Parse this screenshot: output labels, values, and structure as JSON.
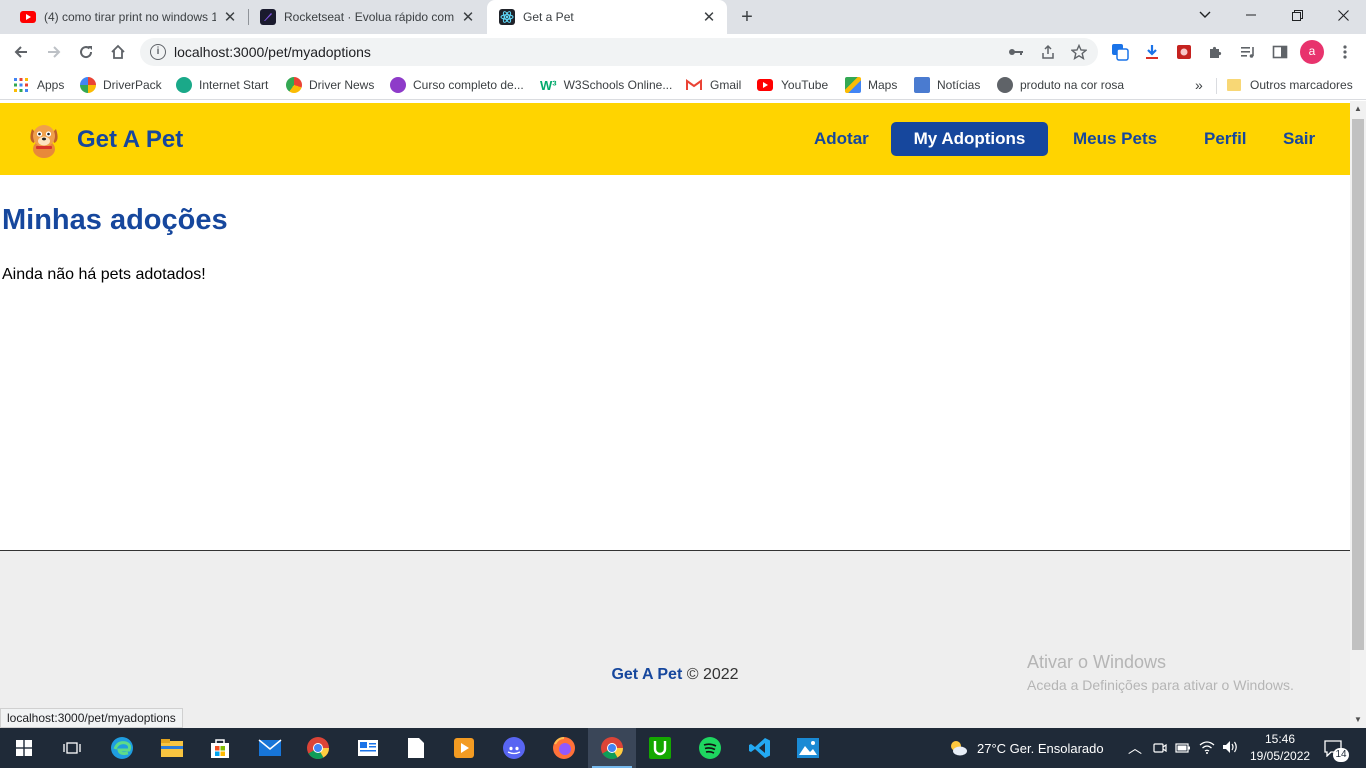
{
  "browser": {
    "tabs": [
      {
        "title": "(4) como tirar print no windows 1",
        "icon": "youtube-icon"
      },
      {
        "title": "Rocketseat · Evolua rápido como",
        "icon": "rocketseat-icon"
      },
      {
        "title": "Get a Pet",
        "icon": "react-icon",
        "active": true
      }
    ],
    "url": "localhost:3000/pet/myadoptions",
    "avatar_letter": "a",
    "bookmarks": [
      {
        "label": "Apps",
        "icon": "apps-grid-icon"
      },
      {
        "label": "DriverPack",
        "icon": "driverpack-icon"
      },
      {
        "label": "Internet Start",
        "icon": "internet-start-icon"
      },
      {
        "label": "Driver News",
        "icon": "driver-news-icon"
      },
      {
        "label": "Curso completo de...",
        "icon": "course-icon"
      },
      {
        "label": "W3Schools Online...",
        "icon": "w3schools-icon"
      },
      {
        "label": "Gmail",
        "icon": "gmail-icon"
      },
      {
        "label": "YouTube",
        "icon": "youtube-icon"
      },
      {
        "label": "Maps",
        "icon": "maps-icon"
      },
      {
        "label": "Notícias",
        "icon": "news-icon"
      },
      {
        "label": "produto na cor rosa",
        "icon": "globe-icon"
      }
    ],
    "other_bookmarks": "Outros marcadores",
    "status_url": "localhost:3000/pet/myadoptions"
  },
  "app": {
    "brand": "Get A Pet",
    "nav": [
      {
        "label": "Adotar"
      },
      {
        "label": "My Adoptions",
        "active": true
      },
      {
        "label": "Meus Pets"
      },
      {
        "label": "Perfil"
      },
      {
        "label": "Sair"
      }
    ],
    "heading": "Minhas adoções",
    "empty_message": "Ainda não há pets adotados!",
    "footer": {
      "brand": "Get A Pet",
      "copyright": "© 2022"
    },
    "colors": {
      "navbar": "#ffd400",
      "primary": "#16479d",
      "footer_bg": "#eeeeee"
    }
  },
  "watermark": {
    "title": "Ativar o Windows",
    "subtitle": "Aceda a Definições para ativar o Windows."
  },
  "taskbar": {
    "weather": "27°C  Ger. Ensolarado",
    "time": "15:46",
    "date": "19/05/2022",
    "notifications": "14"
  }
}
